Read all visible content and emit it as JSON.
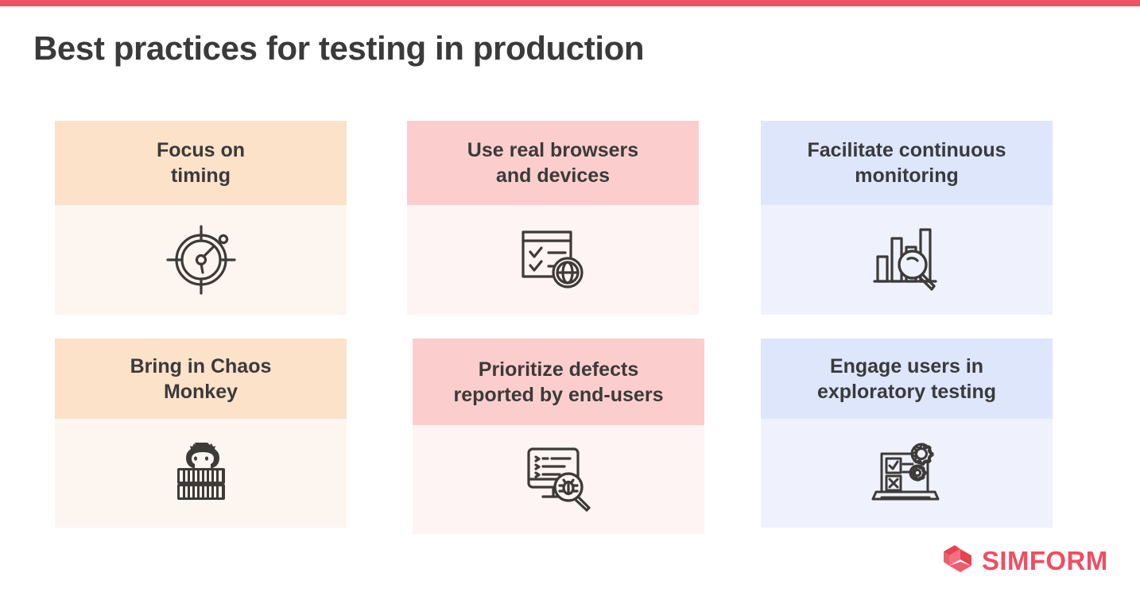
{
  "page": {
    "title": "Best practices for testing in production",
    "accent_bar_color": "#ef5266",
    "background_color": "#ffffff",
    "title_color": "#3a3a3a"
  },
  "cards": [
    {
      "title": "Focus on timing",
      "title_line1": "Focus on",
      "title_line2": "timing",
      "icon": "stopwatch-target-icon",
      "header_color": "#fbe2c9",
      "body_color": "#fdf5f0"
    },
    {
      "title": "Use real browsers and devices",
      "title_line1": "Use real browsers",
      "title_line2": "and devices",
      "icon": "checklist-globe-icon",
      "header_color": "#fbcecd",
      "body_color": "#fdf4f3"
    },
    {
      "title": "Facilitate continuous monitoring",
      "title_line1": "Facilitate continuous",
      "title_line2": "monitoring",
      "icon": "bar-chart-magnifier-icon",
      "header_color": "#dde6fb",
      "body_color": "#eff2fd"
    },
    {
      "title": "Bring in Chaos Monkey",
      "title_line1": "Bring in Chaos",
      "title_line2": "Monkey",
      "icon": "chaos-monkey-logo-icon",
      "icon_text_line1": "CHAOS",
      "icon_text_line2": "MONKEY",
      "header_color": "#fbe2c9",
      "body_color": "#fdf5f0"
    },
    {
      "title": "Prioritize defects reported by end-users",
      "title_line1": "Prioritize defects",
      "title_line2": "reported by end-users",
      "icon": "monitor-bug-magnifier-icon",
      "header_color": "#fbcecd",
      "body_color": "#fdf4f3"
    },
    {
      "title": "Engage users in exploratory testing",
      "title_line1": "Engage users in",
      "title_line2": "exploratory testing",
      "icon": "laptop-checklist-gears-icon",
      "header_color": "#dde6fb",
      "body_color": "#eff2fd"
    }
  ],
  "brand": {
    "name": "SIMFORM",
    "logo_icon": "simform-ribbon-logo-icon",
    "color": "#ef4d62"
  }
}
